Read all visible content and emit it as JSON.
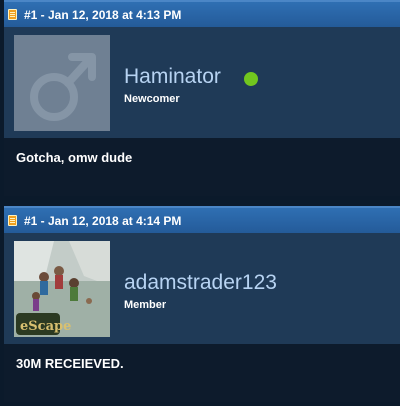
{
  "posts": [
    {
      "header": "#1 - Jan 12, 2018 at 4:13 PM",
      "username": "Haminator",
      "title": "Newcomer",
      "online": true,
      "body": "Gotcha, omw dude"
    },
    {
      "header": "#1 - Jan 12, 2018 at 4:14 PM",
      "username": "adamstrader123",
      "title": "Member",
      "online": false,
      "body": "30M RECEIEVED.",
      "avatar_watermark": "eScape"
    }
  ],
  "colors": {
    "header_blue": "#2a65a8",
    "profile_bg": "#1f3a57",
    "body_bg": "#0d1b2c",
    "username": "#b7d3f2",
    "online": "#71c61f"
  }
}
